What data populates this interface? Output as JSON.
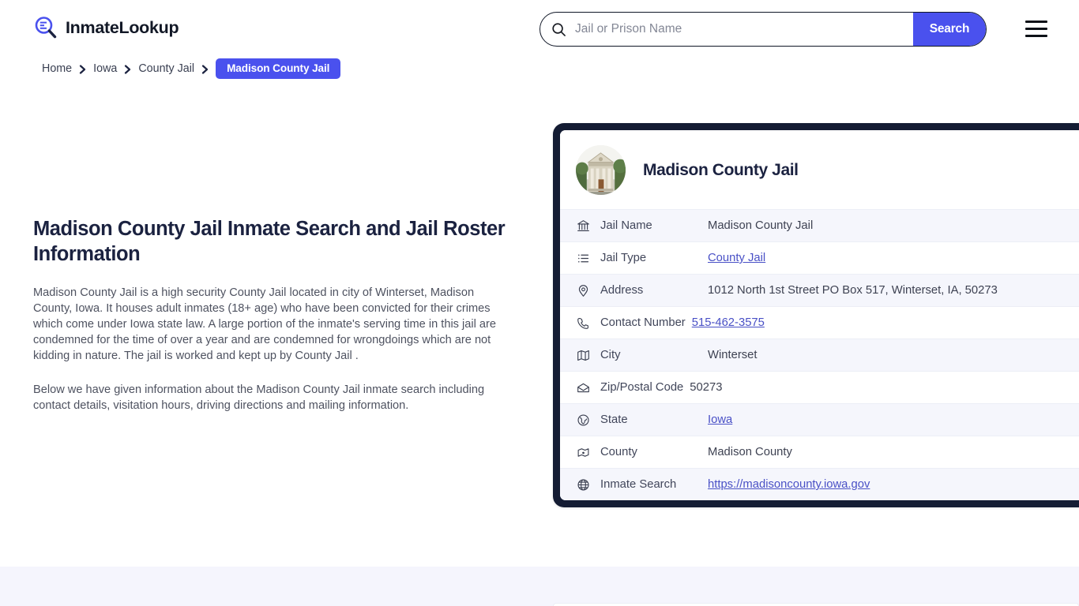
{
  "header": {
    "brand_name": "InmateLookup",
    "brand_icon": "magnifier-list-icon",
    "search": {
      "placeholder": "Jail or Prison Name",
      "value": "",
      "button_label": "Search",
      "icon": "search-icon"
    },
    "menu_icon": "hamburger-menu-icon"
  },
  "breadcrumb": {
    "items": [
      {
        "label": "Home"
      },
      {
        "label": "Iowa"
      },
      {
        "label": "County Jail"
      }
    ],
    "current": "Madison County Jail",
    "separator_icon": "chevron-right-icon"
  },
  "main": {
    "title": "Madison County Jail Inmate Search and Jail Roster Information",
    "paragraphs": [
      "Madison County Jail is a high security County Jail located in city of Winterset, Madison County, Iowa. It houses adult inmates (18+ age) who have been convicted for their crimes which come under Iowa state law. A large portion of the inmate's serving time in this jail are condemned for the time of over a year and are condemned for wrongdoings which are not kidding in nature. The jail is worked and kept up by County Jail .",
      "Below we have given information about the Madison County Jail inmate search including contact details, visitation hours, driving directions and mailing information."
    ]
  },
  "info_card": {
    "title": "Madison County Jail",
    "photo_alt": "Madison County Courthouse",
    "rows": [
      {
        "icon": "bank-icon",
        "label": "Jail Name",
        "value": "Madison County Jail",
        "link": false
      },
      {
        "icon": "list-icon",
        "label": "Jail Type",
        "value": "County Jail",
        "link": true
      },
      {
        "icon": "map-pin-icon",
        "label": "Address",
        "value": "1012 North 1st Street PO Box 517, Winterset, IA, 50273",
        "link": false
      },
      {
        "icon": "phone-icon",
        "label": "Contact Number",
        "value": "515-462-3575",
        "link": true
      },
      {
        "icon": "map-icon",
        "label": "City",
        "value": "Winterset",
        "link": false
      },
      {
        "icon": "envelope-icon",
        "label": "Zip/Postal Code",
        "value": "50273",
        "link": false
      },
      {
        "icon": "globe-pin-icon",
        "label": "State",
        "value": "Iowa",
        "link": true
      },
      {
        "icon": "county-map-icon",
        "label": "County",
        "value": "Madison County",
        "link": false
      },
      {
        "icon": "globe-icon",
        "label": "Inmate Search",
        "value": "https://madisoncounty.iowa.gov",
        "link": true
      }
    ]
  },
  "colors": {
    "accent_blue": "#4a51ee",
    "card_border_navy": "#141c33",
    "heading_navy": "#1b2240",
    "link_indigo": "#4950c6",
    "row_alt_bg": "#f5f6fc",
    "band_bg": "#f5f5fd"
  }
}
